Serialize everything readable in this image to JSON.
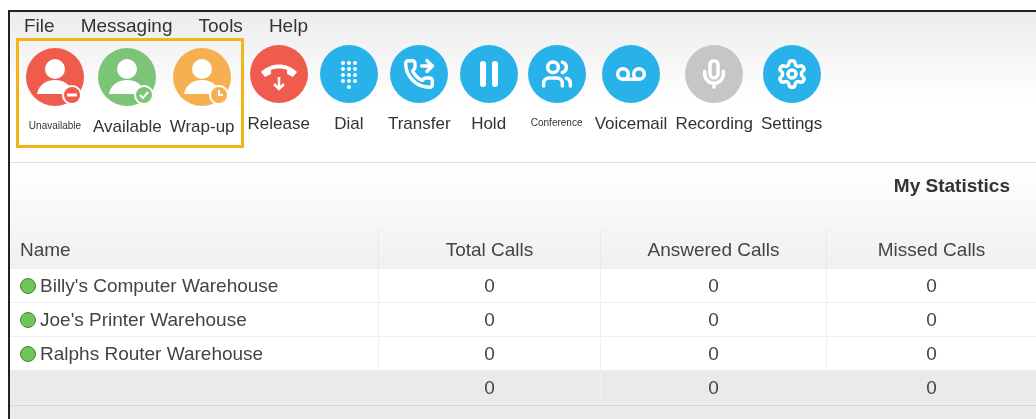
{
  "menu": [
    "File",
    "Messaging",
    "Tools",
    "Help"
  ],
  "status_group": {
    "highlighted": true,
    "buttons": [
      {
        "kind": "unavailable",
        "label": "Unavailable",
        "color": "#ef5b4c"
      },
      {
        "kind": "available",
        "label": "Available",
        "color": "#7cc576"
      },
      {
        "kind": "wrapup",
        "label": "Wrap-up",
        "color": "#f6b04f"
      }
    ]
  },
  "call_buttons": [
    {
      "kind": "release",
      "label": "Release",
      "color": "#ef5b4c"
    },
    {
      "kind": "dial",
      "label": "Dial",
      "color": "#29b2ea"
    },
    {
      "kind": "transfer",
      "label": "Transfer",
      "color": "#29b2ea"
    },
    {
      "kind": "hold",
      "label": "Hold",
      "color": "#29b2ea"
    },
    {
      "kind": "conference",
      "label": "Conference",
      "color": "#29b2ea"
    },
    {
      "kind": "voicemail",
      "label": "Voicemail",
      "color": "#29b2ea"
    },
    {
      "kind": "recording",
      "label": "Recording",
      "color": "#c4c6c8"
    },
    {
      "kind": "settings",
      "label": "Settings",
      "color": "#29b2ea"
    }
  ],
  "table": {
    "title": "My Statistics",
    "columns": [
      "Name",
      "Total Calls",
      "Answered Calls",
      "Missed Calls"
    ],
    "rows": [
      {
        "color": "#72c35a",
        "cells": [
          "Billy's Computer Warehouse",
          "0",
          "0",
          "0"
        ]
      },
      {
        "color": "#72c35a",
        "cells": [
          "Joe's Printer Warehouse",
          "0",
          "0",
          "0"
        ]
      },
      {
        "color": "#72c35a",
        "cells": [
          "Ralphs Router Warehouse",
          "0",
          "0",
          "0"
        ]
      }
    ],
    "totals": [
      "0",
      "0",
      "0"
    ]
  }
}
